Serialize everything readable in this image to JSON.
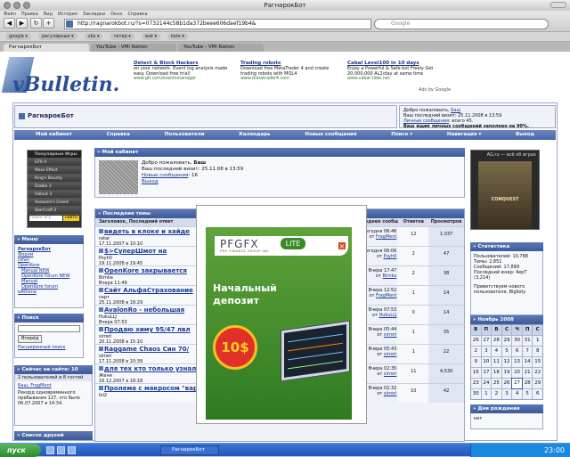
{
  "window": {
    "title": "РагнарокБот"
  },
  "menu": [
    "Файл",
    "Правка",
    "Вид",
    "История",
    "Закладки",
    "Окно",
    "Справка"
  ],
  "address": {
    "url": "http://ragnarokbot.ru/?s=0732144c58b1da372beee606daef19b4&",
    "search_placeholder": "Google"
  },
  "bookmarks": [
    "google ▾",
    "регулярные ▾",
    "vbs ▾",
    "тетер ▾",
    "wat ▾",
    "kote ▾"
  ],
  "tabs": [
    "РагнарокБот",
    "YouTube - VMi Nation",
    "YouTube - VMi Nation"
  ],
  "logo": {
    "text": "vBulletin."
  },
  "ads": [
    {
      "title": "Detect & Block Hackers",
      "text": "on your network. Event log analysis made easy. Download free trial!",
      "url": "www.gfi.com/eventsmanager"
    },
    {
      "title": "Trading robots",
      "text": "Download free MetaTrader 4 and create trading robots with MQL4",
      "url": "www.metatrader4.com"
    },
    {
      "title": "Cabal Level100 in 10 days",
      "text": "Enjoy a Powerful & Safe bot Freely Get 20,000,000 AL2/day at same time",
      "url": "www.cabal-rider.net"
    }
  ],
  "ads_by": "Ads by Google",
  "forum": {
    "title": "РагнарокБот"
  },
  "welcome": {
    "greeting": "Добро пожаловать,",
    "user": "Баш",
    "last_visit": "Ваш последний визит: 25.11.2008 в 13:59",
    "pm_link": "Личные сообщения",
    "pm_count": ": всего 45.",
    "warning": "Ваш ящик личных сообщений заполнен на 90%."
  },
  "nav": [
    "Мой кабинет",
    "Справка",
    "Пользователи",
    "Календарь",
    "Новые сообщения",
    "Поиск ▾",
    "Навигация ▾",
    "Выход"
  ],
  "games": {
    "title": "Популярные Игры",
    "items": [
      "GTA 4",
      "Mass Effect",
      "King's Bounty",
      "Diablo 3",
      "Fallout 3",
      "Assassin's Creed",
      "StarCraft 2"
    ],
    "search_placeholder": "поиск игр",
    "search_button": "найти"
  },
  "cabinet": {
    "title": "» Мой кабинет",
    "greeting": "Добро пожаловать,",
    "user": "Баш",
    "last_visit": "Ваш последний визит: 25.11.08 в 13:59",
    "new_msgs_label": "Новые сообщения",
    "new_msgs_count": ": 16",
    "logout": "Выход"
  },
  "menu_box": {
    "title": "» Меню",
    "items": [
      "РагнарокБот",
      "Форум",
      "rofan",
      "OpenKore",
      "Manual NEW",
      "OpenKore forum NEW",
      "Manual",
      "OpenKore forum",
      "eAthena"
    ]
  },
  "search_box": {
    "title": "» Поиск",
    "button": "Вперёд",
    "ext_link": "Расширенный поиск"
  },
  "online_box": {
    "title": "» Сейчас на сайте: 10",
    "summary": "2 пользователей и 8 гостей",
    "users": "Баш, FragMent",
    "record": "Рекорд одновременного пребывания 127, это было 06.07.2007 в 14:34."
  },
  "friends_box": {
    "title": "» Список друзей"
  },
  "threads": {
    "title": "» Последние темы",
    "headers": [
      "Заголовок, Последний ответ",
      "Последнее сообщ.",
      "Ответов",
      "Просмотров"
    ],
    "rows": [
      {
        "title": "видеть в клоке и хайде",
        "author": "ratar",
        "date": "17.11.2007 в 10:10",
        "last": "Сегодня 06:46",
        "by": "FragMent",
        "replies": "12",
        "views": "1,037"
      },
      {
        "title": "$>СуперШмот на",
        "author": "Psyh0",
        "date": "19.11.2008 в 19:45",
        "last": "Сегодня 06:06",
        "by": "Psyh0",
        "replies": "2",
        "views": "47"
      },
      {
        "title": "OpenKore закрывается",
        "author": "Birnka",
        "date": "Вчера 11:49",
        "last": "Вчера 17:47",
        "by": "Birnka",
        "replies": "2",
        "views": "38"
      },
      {
        "title": "Сайт АльфаСтрахование",
        "author": "серт",
        "date": "25.11.2008 в 18:29",
        "last": "Вчера 12:52",
        "by": "FragMent",
        "replies": "1",
        "views": "14"
      },
      {
        "title": "AvalonRo - небольшая",
        "author": "HukuLLJ",
        "date": "Вчера 07:53",
        "last": "Вчера 07:53",
        "by": "HukuLLJ",
        "replies": "0",
        "views": "14"
      },
      {
        "title": "Продаю химу 95/47 лвл",
        "author": "sirreri",
        "date": "20.11.2008 в 15:10",
        "last": "Вчера 05:44",
        "by": "sirreri",
        "replies": "1",
        "views": "35"
      },
      {
        "title": "Raggame Chaos Син 70/",
        "author": "sirreri",
        "date": "17.11.2008 в 10:39",
        "last": "Вчера 05:43",
        "by": "sirreri",
        "replies": "1",
        "views": "22"
      },
      {
        "title": "для тех кто только узнал",
        "author": "Женя",
        "date": "16.12.2007 в 18:18",
        "last": "Вчера 02:35",
        "by": "sirreri",
        "replies": "11",
        "views": "4,539"
      },
      {
        "title": "Пролема с макросом \"варп",
        "author": "lol2",
        "date": "",
        "last": "Вчера 02:32",
        "by": "sirreri",
        "replies": "10",
        "views": "42"
      }
    ]
  },
  "ag": {
    "title": "AG.ru — всё об играх",
    "caption": "CONQUEST"
  },
  "stats": {
    "title": "» Статистика",
    "lines": [
      "Пользователей: 10,788",
      "Темы: 2,851",
      "Сообщений: 17,899",
      "Последний юзер: 4ерТ",
      "(3,214)",
      "Приветствуем нового пользователя, Bigbsty"
    ]
  },
  "calendar": {
    "title": "» Ноябрь 2008",
    "days": [
      "В",
      "П",
      "В",
      "С",
      "Ч",
      "П",
      "С"
    ],
    "cells": [
      "26",
      "27",
      "28",
      "29",
      "30",
      "31",
      "1",
      "2",
      "3",
      "4",
      "5",
      "6",
      "7",
      "8",
      "9",
      "10",
      "11",
      "12",
      "13",
      "14",
      "15",
      "16",
      "17",
      "18",
      "19",
      "20",
      "21",
      "22",
      "23",
      "24",
      "25",
      "26",
      "27",
      "28",
      "29",
      "30",
      "1",
      "2",
      "3",
      "4",
      "5",
      "6"
    ],
    "today": "27"
  },
  "bday": {
    "title": "» Дни рождения",
    "text": "нет"
  },
  "popup": {
    "logo_left": "PFGFX",
    "logo_right": "LITE",
    "tagline": "PRO FINANCE GROUP INC",
    "line1": "Начальный",
    "line2": "депозит",
    "badge": "10$",
    "close": "×"
  },
  "taskbar": {
    "start": "пуск",
    "items": [
      "РагнарокБот"
    ],
    "time": "23:00"
  }
}
